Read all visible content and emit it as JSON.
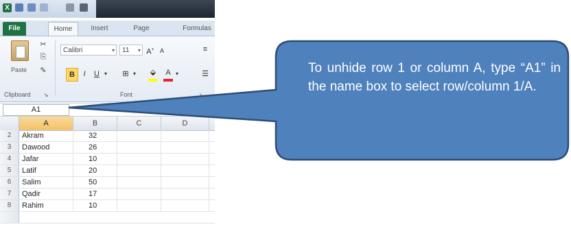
{
  "ribbon": {
    "tabs": [
      "File",
      "Home",
      "Insert",
      "Page Layout",
      "Formulas"
    ],
    "font_name": "Calibri",
    "font_size": "11",
    "paste_label": "Paste",
    "clipboard_label": "Clipboard",
    "font_group_label": "Font"
  },
  "namebox": {
    "value": "A1"
  },
  "grid": {
    "columns": [
      "A",
      "B",
      "C",
      "D"
    ],
    "rows": [
      {
        "num": "2",
        "a": "Akram",
        "b": "32"
      },
      {
        "num": "3",
        "a": "Dawood",
        "b": "26"
      },
      {
        "num": "4",
        "a": "Jafar",
        "b": "10"
      },
      {
        "num": "5",
        "a": "Latif",
        "b": "20"
      },
      {
        "num": "6",
        "a": "Salim",
        "b": "50"
      },
      {
        "num": "7",
        "a": "Qadir",
        "b": "17"
      },
      {
        "num": "8",
        "a": "Rahim",
        "b": "10"
      }
    ]
  },
  "callout": {
    "text": "To unhide row 1 or column A, type “A1” in the name box to select row/column 1/A."
  },
  "colors": {
    "callout_fill": "#4f81bd",
    "callout_stroke": "#2c4d75",
    "file_tab": "#1f7244",
    "selected_header": "#f7c86e"
  }
}
